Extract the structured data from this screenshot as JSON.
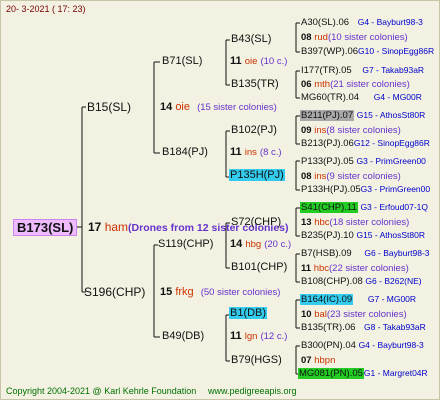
{
  "header_date": "20-  3-2021 (  17:  23)",
  "footer": {
    "copyright": "Copyright 2004-2021 @ Karl Kehrle Foundation",
    "site": "www.pedigreeapis.org"
  },
  "root": {
    "id": "B173(SL)",
    "num": "17",
    "name": "ham",
    "note": "(Drones from 12 sister colonies)"
  },
  "level1": [
    {
      "id": "B15(SL)",
      "num": "14",
      "name": "oie",
      "sis": "(15 sister colonies)"
    },
    {
      "id": "S196(CHP)",
      "num": "15",
      "name": "frkg",
      "sis": "(50 sister colonies)"
    }
  ],
  "level2": [
    {
      "id": "B71(SL)",
      "num": "11",
      "name": "oie",
      "sis": "(10 c.)"
    },
    {
      "id": "B184(PJ)",
      "num": "11",
      "name": "ins",
      "sis": "(8 c.)"
    },
    {
      "id": "S119(CHP)",
      "num": "14",
      "name": "hbg",
      "sis": "(20 c.)"
    },
    {
      "id": "B49(DB)",
      "num": "11",
      "name": "lgn",
      "sis": "(12 c.)"
    }
  ],
  "level3": [
    {
      "id": "B43(SL)"
    },
    {
      "id": "B135(TR)"
    },
    {
      "id": "B102(PJ)"
    },
    {
      "id": "P135H(PJ)"
    },
    {
      "id": "S72(CHP)"
    },
    {
      "id": "B101(CHP)"
    },
    {
      "id": "B1(DB)"
    },
    {
      "id": "B79(HGS)"
    }
  ],
  "level4": [
    {
      "top": "A30(SL).06",
      "topref": "G4 - Bayburt98-3",
      "num": "08",
      "name": "rud",
      "sis": "(10 sister colonies)",
      "bot": "B397(WP).06",
      "botref": "G10 - SinopEgg86R"
    },
    {
      "top": "I177(TR).05",
      "topref": "G7 - Takab93aR",
      "num": "06",
      "name": "mth",
      "sis": "(21 sister colonies)",
      "bot": "MG60(TR).04",
      "botref": "G4 - MG00R"
    },
    {
      "top": "B211(PJ).07",
      "topref": "G15 - AthosSt80R",
      "num": "09",
      "name": "ins",
      "sis": "(8 sister colonies)",
      "bot": "B213(PJ).06",
      "botref": "G12 - SinopEgg86R"
    },
    {
      "top": "P133(PJ).05",
      "topref": "G3 - PrimGreen00",
      "num": "08",
      "name": "ins",
      "sis": "(9 sister colonies)",
      "bot": "P133H(PJ).05",
      "botref": "G3 - PrimGreen00"
    },
    {
      "top": "S41(CHP).11",
      "topref": "G3 - Erfoud07-1Q",
      "num": "13",
      "name": "hbc",
      "sis": "(18 sister colonies)",
      "bot": "B235(PJ).10",
      "botref": "G15 - AthosSt80R"
    },
    {
      "top": "B7(HSB).09",
      "topref": "G6 - Bayburt98-3",
      "num": "11",
      "name": "hbc",
      "sis": "(22 sister colonies)",
      "bot": "B108(CHP).08",
      "botref": "G6 - B262(NE)"
    },
    {
      "top": "B164(IC).09",
      "topref": "G7 - MG00R",
      "num": "10",
      "name": "bal",
      "sis": "(23 sister colonies)",
      "bot": "B135(TR).06",
      "botref": "G8 - Takab93aR"
    },
    {
      "top": "B300(PN).04",
      "topref": "G4 - Bayburt98-3",
      "num": "07",
      "name": "hbpn",
      "sis": "",
      "bot": "MG081(PN).05",
      "botref": "G1 - Margret04R"
    }
  ]
}
